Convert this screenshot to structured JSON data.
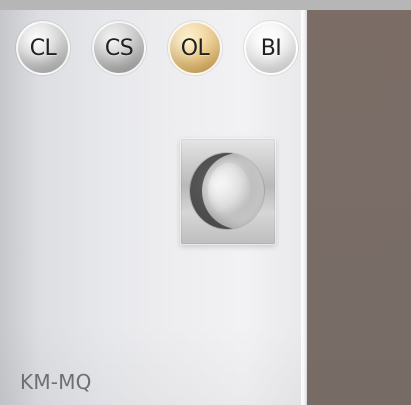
{
  "finishes": [
    {
      "code": "CL",
      "tone": "chrome",
      "color": "#bdbdbd"
    },
    {
      "code": "CS",
      "tone": "satin-chrome",
      "color": "#b3b3b3"
    },
    {
      "code": "OL",
      "tone": "polished-gold",
      "color": "#e7bf72"
    },
    {
      "code": "BI",
      "tone": "white",
      "color": "#f2f2f2"
    }
  ],
  "product": {
    "model_code": "KM-MQ"
  },
  "colors": {
    "wall": "#7a6d67",
    "door": "#ecedf0",
    "model_text": "#6b6f76"
  }
}
